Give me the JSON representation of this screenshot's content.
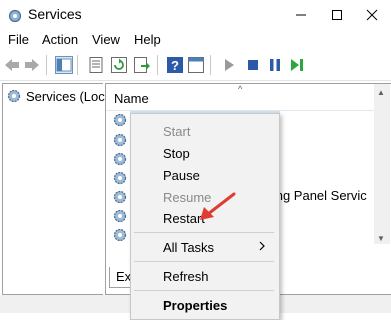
{
  "window": {
    "title": "Services",
    "icons": {
      "app": "gear-icon",
      "minimize": "minimize-icon",
      "maximize": "maximize-icon",
      "close": "close-icon"
    }
  },
  "menubar": {
    "items": [
      "File",
      "Action",
      "View",
      "Help"
    ]
  },
  "toolbar": {
    "icons": [
      "back-arrow-icon",
      "forward-arrow-icon",
      "show-hide-tree-icon",
      "properties-icon",
      "refresh-icon",
      "export-list-icon",
      "help-icon",
      "console-window-icon",
      "start-service-icon",
      "stop-service-icon",
      "pause-service-icon",
      "restart-service-icon"
    ]
  },
  "tree": {
    "item_label": "Services (Loca"
  },
  "list": {
    "column_name": "Name",
    "partial_row_text": "riting Panel Servic",
    "row_icon": "service-gear-icon"
  },
  "bottom_tabs": {
    "extended_partial": "Ex"
  },
  "context_menu": {
    "start": "Start",
    "stop": "Stop",
    "pause": "Pause",
    "resume": "Resume",
    "restart": "Restart",
    "all_tasks": "All Tasks",
    "refresh": "Refresh",
    "properties": "Properties",
    "submenu_icon": "chevron-right-icon"
  },
  "colors": {
    "highlight": "#cce4f7",
    "annotation_arrow": "#e03c31",
    "menu_bg": "#f2f2f2"
  }
}
